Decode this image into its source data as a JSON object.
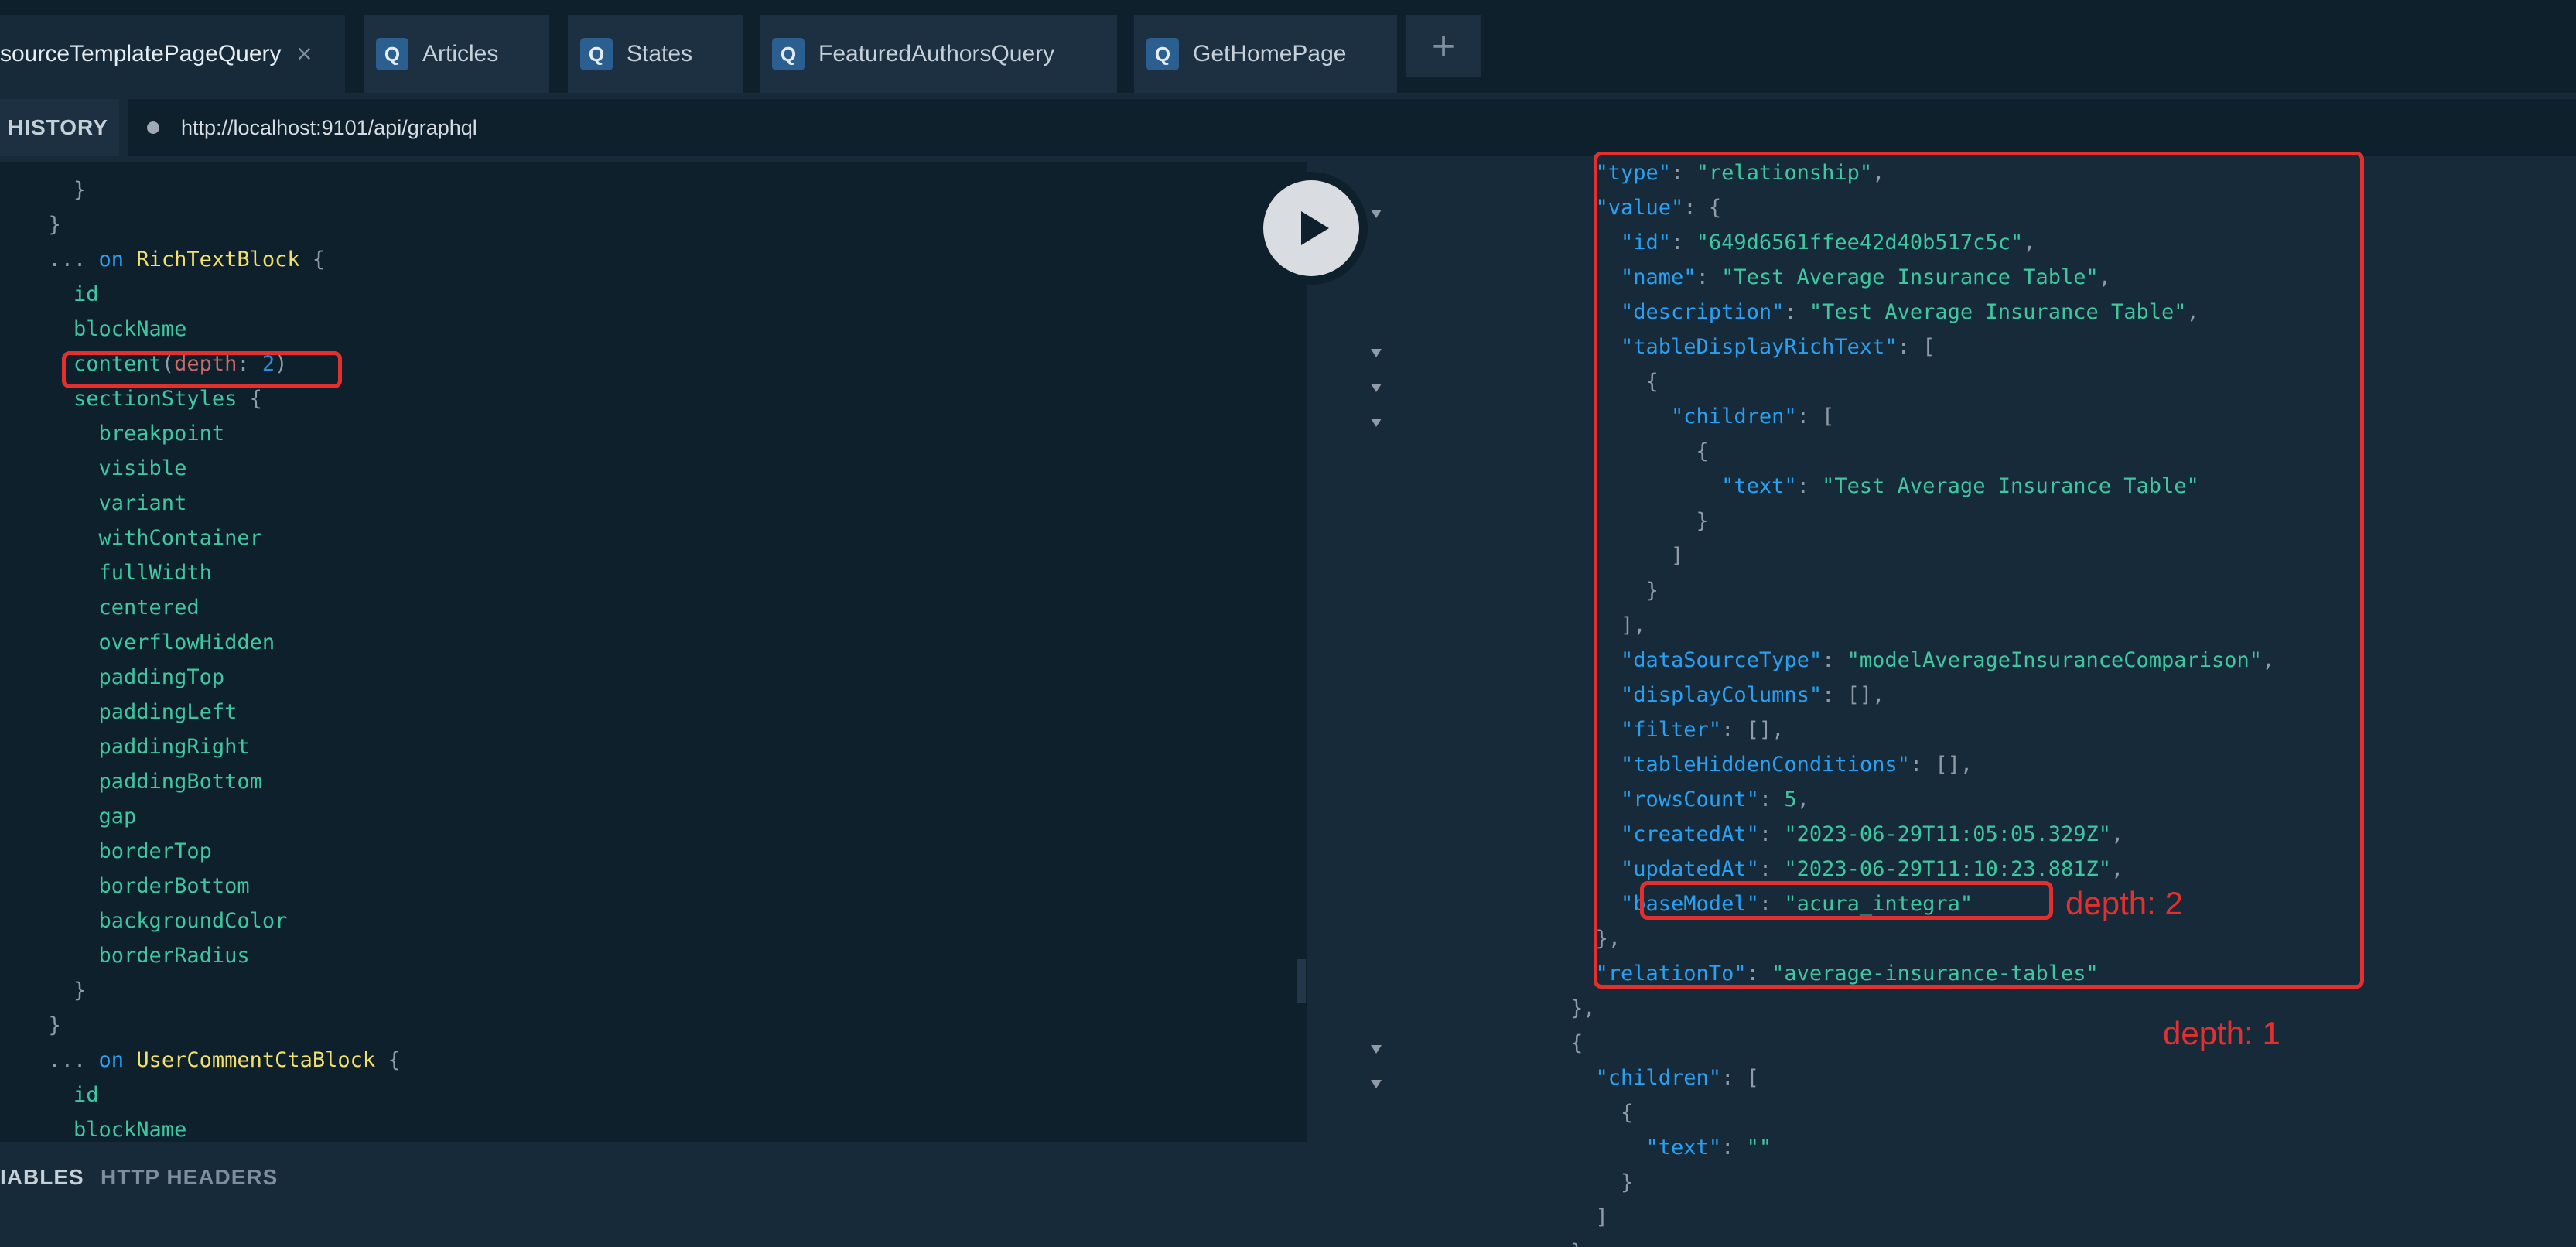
{
  "tabs": [
    {
      "label": "sourceTemplatePageQuery",
      "active": true,
      "badge": ""
    },
    {
      "label": "Articles",
      "active": false,
      "badge": "Q"
    },
    {
      "label": "States",
      "active": false,
      "badge": "Q"
    },
    {
      "label": "FeaturedAuthorsQuery",
      "active": false,
      "badge": "Q"
    },
    {
      "label": "GetHomePage",
      "active": false,
      "badge": "Q"
    }
  ],
  "close_glyph": "×",
  "add_glyph": "+",
  "toolbar": {
    "history_label": "HISTORY",
    "url": "http://localhost:9101/api/graphql"
  },
  "query_lines": [
    [
      [
        "p",
        "    }"
      ]
    ],
    [
      [
        "p",
        "  }"
      ]
    ],
    [
      [
        "p",
        "  ... "
      ],
      [
        "k",
        "on"
      ],
      [
        "p",
        " "
      ],
      [
        "t",
        "RichTextBlock"
      ],
      [
        "p",
        " {"
      ]
    ],
    [
      [
        "f",
        "    id"
      ]
    ],
    [
      [
        "f",
        "    blockName"
      ]
    ],
    [
      [
        "f",
        "    content"
      ],
      [
        "p",
        "("
      ],
      [
        "a",
        "depth"
      ],
      [
        "p",
        ": "
      ],
      [
        "n",
        "2"
      ],
      [
        "p",
        ")"
      ]
    ],
    [
      [
        "f",
        "    sectionStyles"
      ],
      [
        "p",
        " {"
      ]
    ],
    [
      [
        "f",
        "      breakpoint"
      ]
    ],
    [
      [
        "f",
        "      visible"
      ]
    ],
    [
      [
        "f",
        "      variant"
      ]
    ],
    [
      [
        "f",
        "      withContainer"
      ]
    ],
    [
      [
        "f",
        "      fullWidth"
      ]
    ],
    [
      [
        "f",
        "      centered"
      ]
    ],
    [
      [
        "f",
        "      overflowHidden"
      ]
    ],
    [
      [
        "f",
        "      paddingTop"
      ]
    ],
    [
      [
        "f",
        "      paddingLeft"
      ]
    ],
    [
      [
        "f",
        "      paddingRight"
      ]
    ],
    [
      [
        "f",
        "      paddingBottom"
      ]
    ],
    [
      [
        "f",
        "      gap"
      ]
    ],
    [
      [
        "f",
        "      borderTop"
      ]
    ],
    [
      [
        "f",
        "      borderBottom"
      ]
    ],
    [
      [
        "f",
        "      backgroundColor"
      ]
    ],
    [
      [
        "f",
        "      borderRadius"
      ]
    ],
    [
      [
        "p",
        "    }"
      ]
    ],
    [
      [
        "p",
        "  }"
      ]
    ],
    [
      [
        "p",
        "  ... "
      ],
      [
        "k",
        "on"
      ],
      [
        "p",
        " "
      ],
      [
        "t",
        "UserCommentCtaBlock"
      ],
      [
        "p",
        " {"
      ]
    ],
    [
      [
        "f",
        "    id"
      ]
    ],
    [
      [
        "f",
        "    blockName"
      ]
    ]
  ],
  "result_lines": [
    [
      [
        "rk",
        "  \"type\""
      ],
      [
        "p",
        ": "
      ],
      [
        "rs",
        "\"relationship\""
      ],
      [
        "p",
        ","
      ]
    ],
    [
      [
        "rk",
        "  \"value\""
      ],
      [
        "p",
        ": {"
      ]
    ],
    [
      [
        "rk",
        "    \"id\""
      ],
      [
        "p",
        ": "
      ],
      [
        "rs",
        "\"649d6561ffee42d40b517c5c\""
      ],
      [
        "p",
        ","
      ]
    ],
    [
      [
        "rk",
        "    \"name\""
      ],
      [
        "p",
        ": "
      ],
      [
        "rs",
        "\"Test Average Insurance Table\""
      ],
      [
        "p",
        ","
      ]
    ],
    [
      [
        "rk",
        "    \"description\""
      ],
      [
        "p",
        ": "
      ],
      [
        "rs",
        "\"Test Average Insurance Table\""
      ],
      [
        "p",
        ","
      ]
    ],
    [
      [
        "rk",
        "    \"tableDisplayRichText\""
      ],
      [
        "p",
        ": ["
      ]
    ],
    [
      [
        "p",
        "      {"
      ]
    ],
    [
      [
        "rk",
        "        \"children\""
      ],
      [
        "p",
        ": ["
      ]
    ],
    [
      [
        "p",
        "          {"
      ]
    ],
    [
      [
        "rk",
        "            \"text\""
      ],
      [
        "p",
        ": "
      ],
      [
        "rs",
        "\"Test Average Insurance Table\""
      ]
    ],
    [
      [
        "p",
        "          }"
      ]
    ],
    [
      [
        "p",
        "        ]"
      ]
    ],
    [
      [
        "p",
        "      }"
      ]
    ],
    [
      [
        "p",
        "    ],"
      ]
    ],
    [
      [
        "rk",
        "    \"dataSourceType\""
      ],
      [
        "p",
        ": "
      ],
      [
        "rs",
        "\"modelAverageInsuranceComparison\""
      ],
      [
        "p",
        ","
      ]
    ],
    [
      [
        "rk",
        "    \"displayColumns\""
      ],
      [
        "p",
        ": [],"
      ]
    ],
    [
      [
        "rk",
        "    \"filter\""
      ],
      [
        "p",
        ": [],"
      ]
    ],
    [
      [
        "rk",
        "    \"tableHiddenConditions\""
      ],
      [
        "p",
        ": [],"
      ]
    ],
    [
      [
        "rk",
        "    \"rowsCount\""
      ],
      [
        "p",
        ": "
      ],
      [
        "rn",
        "5"
      ],
      [
        "p",
        ","
      ]
    ],
    [
      [
        "rk",
        "    \"createdAt\""
      ],
      [
        "p",
        ": "
      ],
      [
        "rs",
        "\"2023-06-29T11:05:05.329Z\""
      ],
      [
        "p",
        ","
      ]
    ],
    [
      [
        "rk",
        "    \"updatedAt\""
      ],
      [
        "p",
        ": "
      ],
      [
        "rs",
        "\"2023-06-29T11:10:23.881Z\""
      ],
      [
        "p",
        ","
      ]
    ],
    [
      [
        "rk",
        "    \"baseModel\""
      ],
      [
        "p",
        ": "
      ],
      [
        "rs",
        "\"acura_integra\""
      ]
    ],
    [
      [
        "p",
        "  },"
      ]
    ],
    [
      [
        "rk",
        "  \"relationTo\""
      ],
      [
        "p",
        ": "
      ],
      [
        "rs",
        "\"average-insurance-tables\""
      ]
    ],
    [
      [
        "p",
        "},"
      ]
    ],
    [
      [
        "p",
        "{"
      ]
    ],
    [
      [
        "rk",
        "  \"children\""
      ],
      [
        "p",
        ": ["
      ]
    ],
    [
      [
        "p",
        "    {"
      ]
    ],
    [
      [
        "rk",
        "      \"text\""
      ],
      [
        "p",
        ": "
      ],
      [
        "rs",
        "\"\""
      ]
    ],
    [
      [
        "p",
        "    }"
      ]
    ],
    [
      [
        "p",
        "  ]"
      ]
    ],
    [
      [
        "p",
        "}"
      ]
    ]
  ],
  "bottom_tabs": {
    "variables": "IABLES",
    "headers": "HTTP HEADERS"
  },
  "annotations": {
    "depth2": "depth: 2",
    "depth1": "depth: 1"
  }
}
